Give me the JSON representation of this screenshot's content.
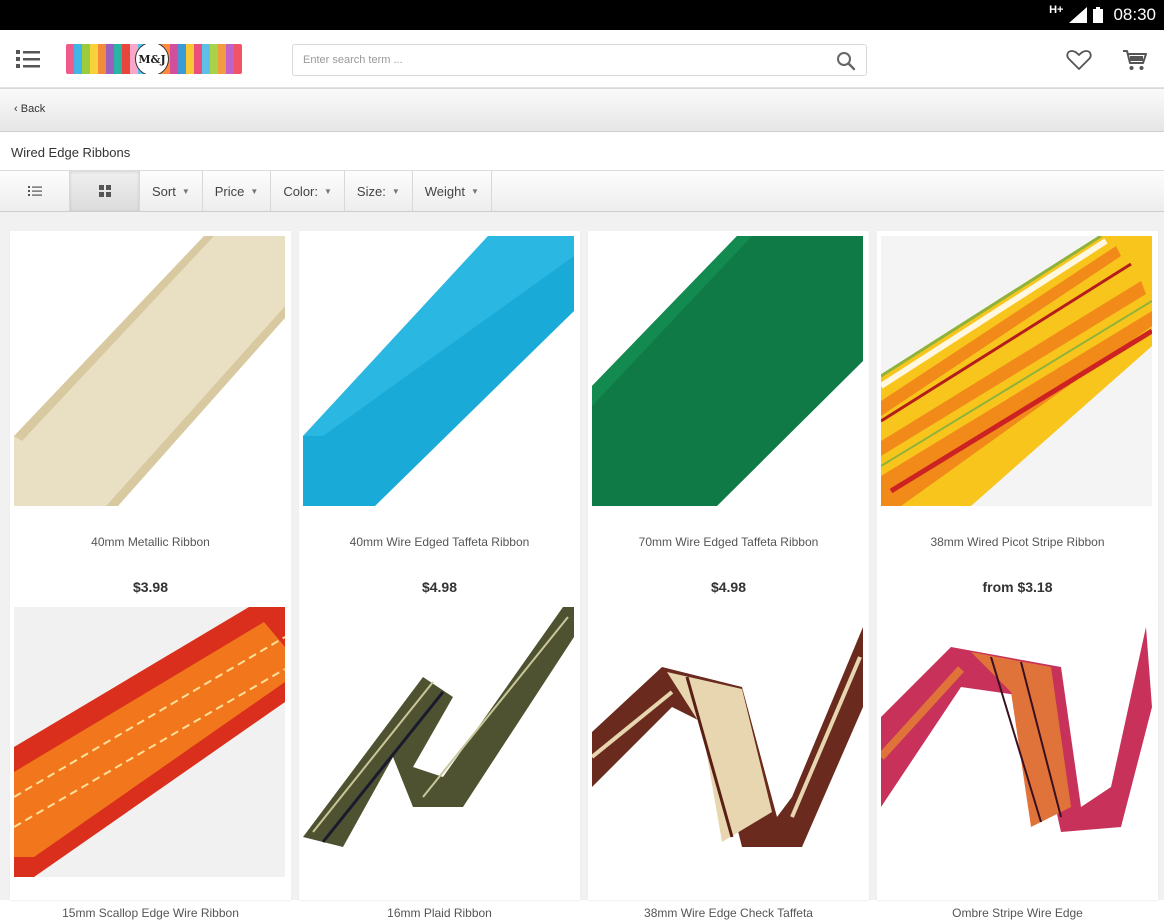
{
  "status_bar": {
    "network": "H+",
    "time": "08:30"
  },
  "header": {
    "logo_text": "M&J",
    "search_placeholder": "Enter search term ..."
  },
  "nav": {
    "back_label": "Back"
  },
  "category": {
    "title": "Wired Edge Ribbons"
  },
  "filters": [
    {
      "label": "Sort"
    },
    {
      "label": "Price"
    },
    {
      "label": "Color:"
    },
    {
      "label": "Size:"
    },
    {
      "label": "Weight"
    }
  ],
  "products": [
    {
      "name": "40mm Metallic Ribbon",
      "price": "$3.98",
      "color": "#e8dcbc"
    },
    {
      "name": "40mm Wire Edged Taffeta Ribbon",
      "price": "$4.98",
      "color": "#1aa9d6"
    },
    {
      "name": "70mm Wire Edged Taffeta Ribbon",
      "price": "$4.98",
      "color": "#0f7a45"
    },
    {
      "name": "38mm Wired Picot Stripe Ribbon",
      "price": "from $3.18",
      "color": "#f7a81b"
    },
    {
      "name": "15mm Scallop Edge Wire Ribbon",
      "price": "",
      "color": "#e8571a"
    },
    {
      "name": "16mm Plaid Ribbon",
      "price": "",
      "color": "#4e5230"
    },
    {
      "name": "38mm Wire Edge Check Taffeta",
      "price": "",
      "color": "#6a2a1e"
    },
    {
      "name": "Ombre Stripe Wire Edge",
      "price": "",
      "color": "#c8325a"
    }
  ]
}
